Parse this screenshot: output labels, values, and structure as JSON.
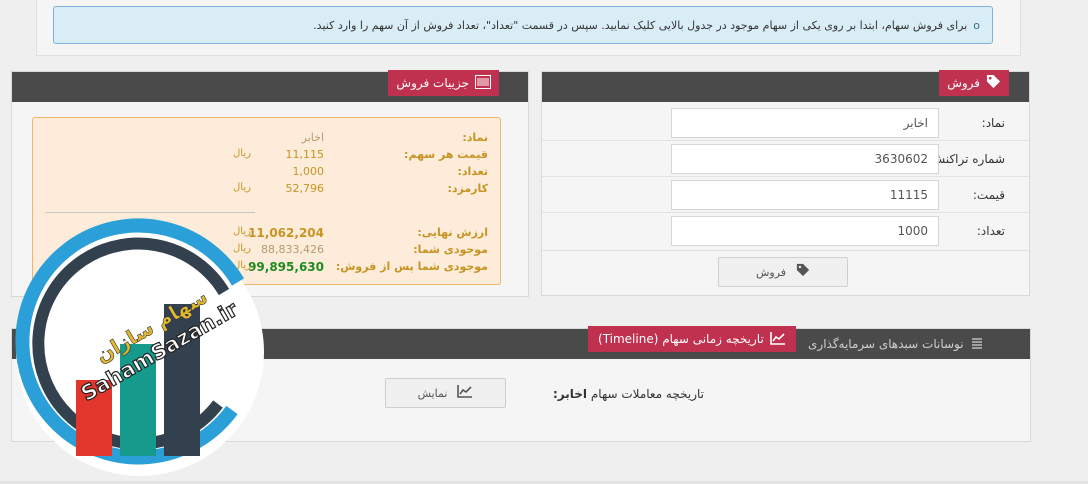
{
  "info": {
    "bullet": "o",
    "text": "برای فروش سهام، ابتدا بر روی یکی از سهام موجود در جدول بالایی کلیک نمایید. سپس در قسمت \"تعداد\"، تعداد فروش از آن سهم را وارد کنید."
  },
  "sell_panel": {
    "title": "فروش",
    "icon": "tag-icon",
    "fields": [
      {
        "label": "نماد:",
        "value": "اخابر"
      },
      {
        "label": "شماره تراکنش:",
        "value": "3630602"
      },
      {
        "label": "قیمت:",
        "value": "11115"
      },
      {
        "label": "تعداد:",
        "value": "1000"
      }
    ],
    "button_label": "فروش"
  },
  "detail_panel": {
    "title": "جزییات فروش",
    "icon": "barcode-icon",
    "rows": {
      "symbol": {
        "label": "نماد:",
        "value": "اخابر"
      },
      "price": {
        "label": "قیمت هر سهم:",
        "value": "11,115",
        "unit": "ریال"
      },
      "count": {
        "label": "تعداد:",
        "value": "1,000"
      },
      "fee": {
        "label": "کارمزد:",
        "value": "52,796",
        "unit": "ریال"
      },
      "final": {
        "label": "ارزش نهایی:",
        "value": "11,062,204",
        "unit": "ریال"
      },
      "balance": {
        "label": "موجودی شما:",
        "value": "88,833,426",
        "unit": "ریال"
      },
      "after": {
        "label": "موجودی شما پس از فروش:",
        "value": "99,895,630",
        "unit": "ریال"
      }
    }
  },
  "timeline_panel": {
    "active_tab": "تاریخچه زمانی سهام (Timeline)",
    "inactive_tab": "نوسانات سبدهای سرمایه‌گذاری",
    "row_label": "تاریخچه معاملات سهام",
    "row_symbol": "اخابر:",
    "button_label": "نمایش"
  },
  "logo": {
    "text_fa": "سهام سازان",
    "text_en": "SahamSazan.ir",
    "colors": {
      "ring": "#2a9fd8",
      "dark": "#33414f",
      "teal": "#159a8c",
      "red": "#e2352c"
    }
  },
  "colors": {
    "accent": "#c0304f",
    "header": "#4a4a4a",
    "info_bg": "#d9edf7",
    "detail_bg": "#fcecd9"
  }
}
